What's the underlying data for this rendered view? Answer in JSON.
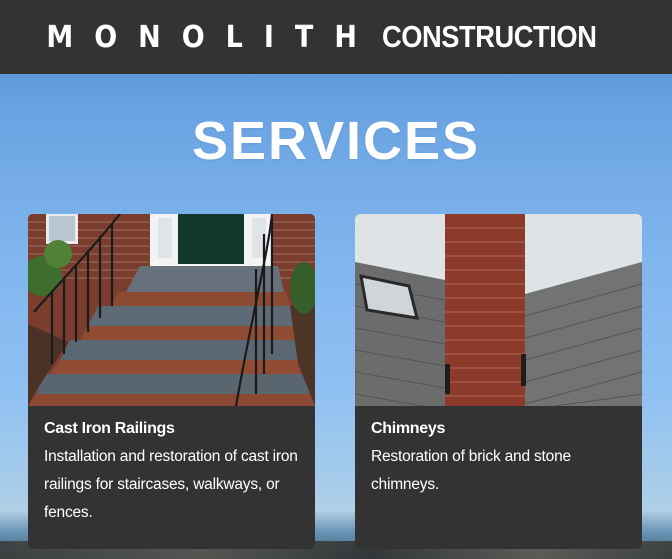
{
  "header": {
    "brand_spaced": "MONOLITH",
    "brand_rest": "CONSTRUCTION"
  },
  "main": {
    "section_title": "SERVICES",
    "services": [
      {
        "title": "Cast Iron Railings",
        "description": "Installation and restoration of cast iron railings for staircases, walkways, or fences.",
        "image": "stone-steps-with-cast-iron-railing"
      },
      {
        "title": "Chimneys",
        "description": "Restoration of brick and stone chimneys.",
        "image": "brick-chimney-on-shingle-roof"
      }
    ]
  },
  "colors": {
    "header_bg": "#333333",
    "card_bg": "#333333",
    "text": "#ffffff",
    "sky": "#7fb5ee"
  }
}
